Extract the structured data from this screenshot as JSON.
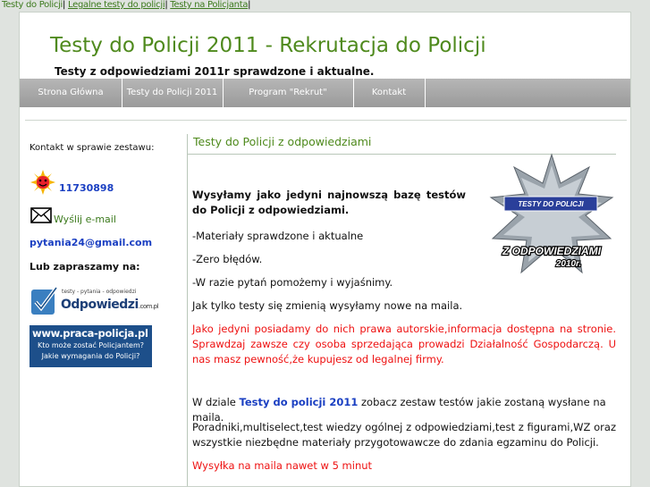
{
  "top_links": [
    {
      "label": "Testy do Policji"
    },
    {
      "label": "Legalne testy do policji"
    },
    {
      "label": "Testy na Policjanta"
    }
  ],
  "header": {
    "title": "Testy do Policji 2011 - Rekrutacja do Policji",
    "subtitle": "Testy z odpowiedziami 2011r sprawdzone i aktualne."
  },
  "nav": [
    {
      "label": "Strona Główna"
    },
    {
      "label": "Testy do Policji 2011"
    },
    {
      "label": "Program \"Rekrut\""
    },
    {
      "label": "Kontakt"
    }
  ],
  "sidebar": {
    "contact_heading": "Kontakt w sprawie zestawu:",
    "phone": "11730898",
    "email_link": "Wyślij e-mail",
    "email_address": "pytania24@gmail.com",
    "invite": "Lub zapraszamy na:",
    "banner1": {
      "tagline": "testy - pytania - odpowiedzi",
      "brand": "Odpowiedzi",
      "suffix": ".com.pl"
    },
    "banner2": {
      "site": "www.praca-policja.pl",
      "line1": "Kto może zostać Policjantem?",
      "line2": "Jakie wymagania do Policji?"
    }
  },
  "main": {
    "title": "Testy do Policji z odpowiedziami",
    "intro": "Wysyłamy jako jedyni najnowszą bazę testów do Policji z odpowiedziami.",
    "bullets": [
      "-Materiały sprawdzone i aktualne",
      "-Zero błędów.",
      "-W razie pytań pomożemy i wyjaśnimy."
    ],
    "line_update": "Jak tylko testy się zmienią wysyłamy nowe na maila.",
    "warning": "Jako jedyni posiadamy do nich prawa autorskie,informacja dostępna na stronie. Sprawdzaj zawsze czy osoba sprzedająca prowadzi Działalność Gospodarczą. U nas masz pewność,że kupujesz od legalnej firmy.",
    "section_prefix": "W dziale",
    "section_link": "Testy do policji 2011",
    "section_suffix": "zobacz zestaw testów jakie zostaną wysłane na maila.",
    "materials": "Poradniki,multiselect,test wiedzy ogólnej z odpowiedziami,test z figurami,WZ oraz wszystkie niezbędne materiały przygotowawcze do zdania egzaminu do Policji.",
    "shipping": "Wysyłka na maila nawet w 5 minut"
  },
  "badge": {
    "top_text": "TESTY DO POLICJI",
    "main_text": "Z ODPOWIEDZIAMI",
    "year": "2010r."
  },
  "colors": {
    "accent_green": "#4f8a1d",
    "link_blue": "#1a3fc2",
    "warning_red": "#e11111",
    "nav_gray": "#a8a8a8"
  }
}
